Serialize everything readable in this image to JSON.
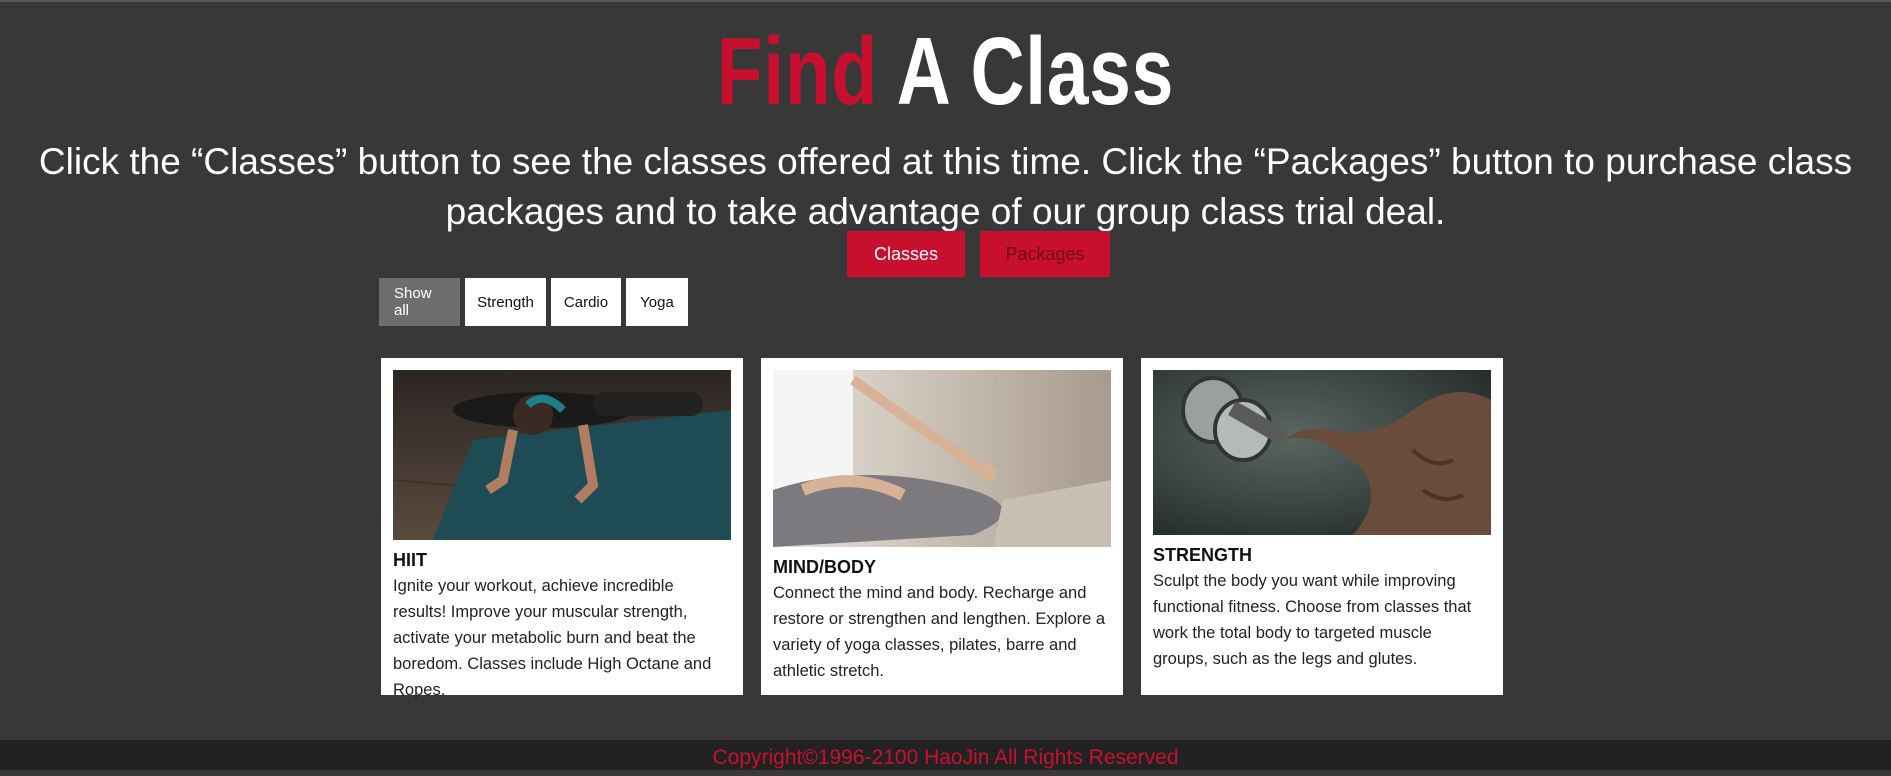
{
  "header": {
    "title_red": "Find",
    "title_white": "A Class",
    "subtitle": "Click the “Classes” button to see the classes offered at this time. Click the “Packages” button to purchase class packages and to take advantage of our group class trial deal."
  },
  "nav_buttons": {
    "classes": "Classes",
    "packages": "Packages"
  },
  "filters": [
    "Show all",
    "Strength",
    "Cardio",
    "Yoga"
  ],
  "active_filter": "Show all",
  "cards": [
    {
      "title": "HIIT",
      "description": "Ignite your workout, achieve incredible results! Improve your muscular strength, activate your metabolic burn and beat the boredom. Classes include High Octane and Ropes.",
      "image": "woman-doing-pushup-on-mat"
    },
    {
      "title": "MIND/BODY",
      "description": "Connect the mind and body. Recharge and restore or strengthen and lengthen. Explore a variety of yoga classes, pilates, barre and athletic stretch.",
      "image": "meditation-pose"
    },
    {
      "title": "STRENGTH",
      "description": "Sculpt the body you want while improving functional fitness. Choose from classes that work the total body to targeted muscle groups, such as the legs and glutes.",
      "image": "muscular-man-with-dumbbell"
    }
  ],
  "footer": {
    "copyright": "Copyright©1996-2100 HaoJin All Rights Reserved"
  },
  "colors": {
    "accent": "#c8102e",
    "background": "#383838",
    "footer_bg": "#222222"
  }
}
